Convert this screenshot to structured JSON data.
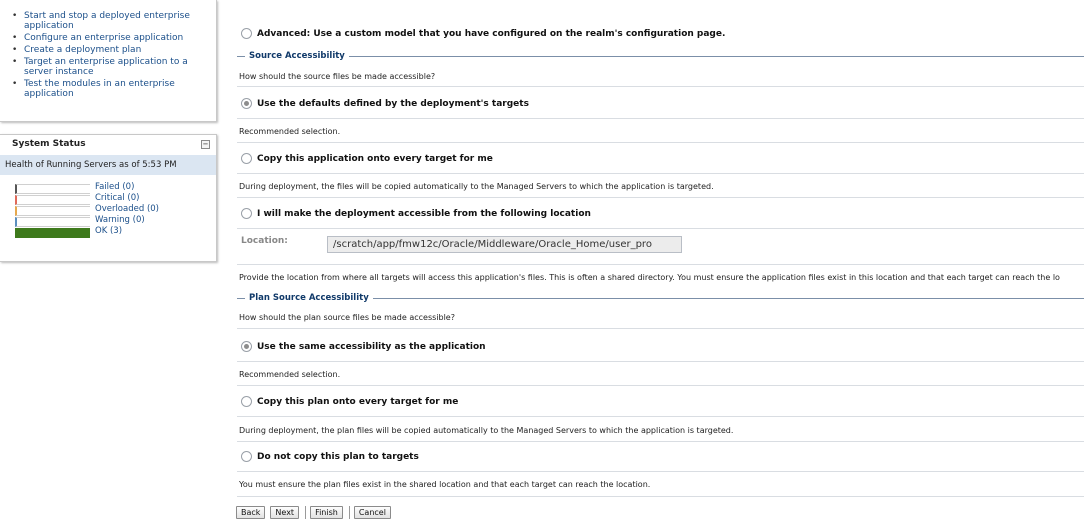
{
  "howto": {
    "items": [
      "Start and stop a deployed enterprise application",
      "Configure an enterprise application",
      "Create a deployment plan",
      "Target an enterprise application to a server instance",
      "Test the modules in an enterprise application"
    ]
  },
  "system_status": {
    "title": "System Status",
    "health_label": "Health of Running Servers as of  5:53 PM",
    "rows": [
      {
        "label": "Failed (0)",
        "color": "#555555",
        "fill_fraction": 0
      },
      {
        "label": "Critical (0)",
        "color": "#e06a5a",
        "fill_fraction": 0
      },
      {
        "label": "Overloaded (0)",
        "color": "#e6a84d",
        "fill_fraction": 0
      },
      {
        "label": "Warning (0)",
        "color": "#5b8fbf",
        "fill_fraction": 0
      },
      {
        "label": "OK (3)",
        "color": "#3e7a1c",
        "fill_fraction": 1
      }
    ]
  },
  "main": {
    "advanced_option": "Advanced: Use a custom model that you have configured on the realm's configuration page.",
    "source": {
      "title": "Source Accessibility",
      "question": "How should the source files be made accessible?",
      "option_defaults": "Use the defaults defined by the deployment's targets",
      "recommended": "Recommended selection.",
      "option_copy": "Copy this application onto every target for me",
      "copy_note": "During deployment, the files will be copied automatically to the Managed Servers to which the application is targeted.",
      "option_location": "I will make the deployment accessible from the following location",
      "location_label": "Location:",
      "location_value": "/scratch/app/fmw12c/Oracle/Middleware/Oracle_Home/user_pro",
      "location_note": "Provide the location from where all targets will access this application's files. This is often a shared directory. You must ensure the application files exist in this location and that each target can reach the lo"
    },
    "plan": {
      "title": "Plan Source Accessibility",
      "question": "How should the plan source files be made accessible?",
      "option_same": "Use the same accessibility as the application",
      "recommended": "Recommended selection.",
      "option_copy": "Copy this plan onto every target for me",
      "copy_note": "During deployment, the plan files will be copied automatically to the Managed Servers to which the application is targeted.",
      "option_nocopy": "Do not copy this plan to targets",
      "nocopy_note": "You must ensure the plan files exist in the shared location and that each target can reach the location."
    },
    "buttons": {
      "back": "Back",
      "next": "Next",
      "finish": "Finish",
      "cancel": "Cancel"
    }
  }
}
